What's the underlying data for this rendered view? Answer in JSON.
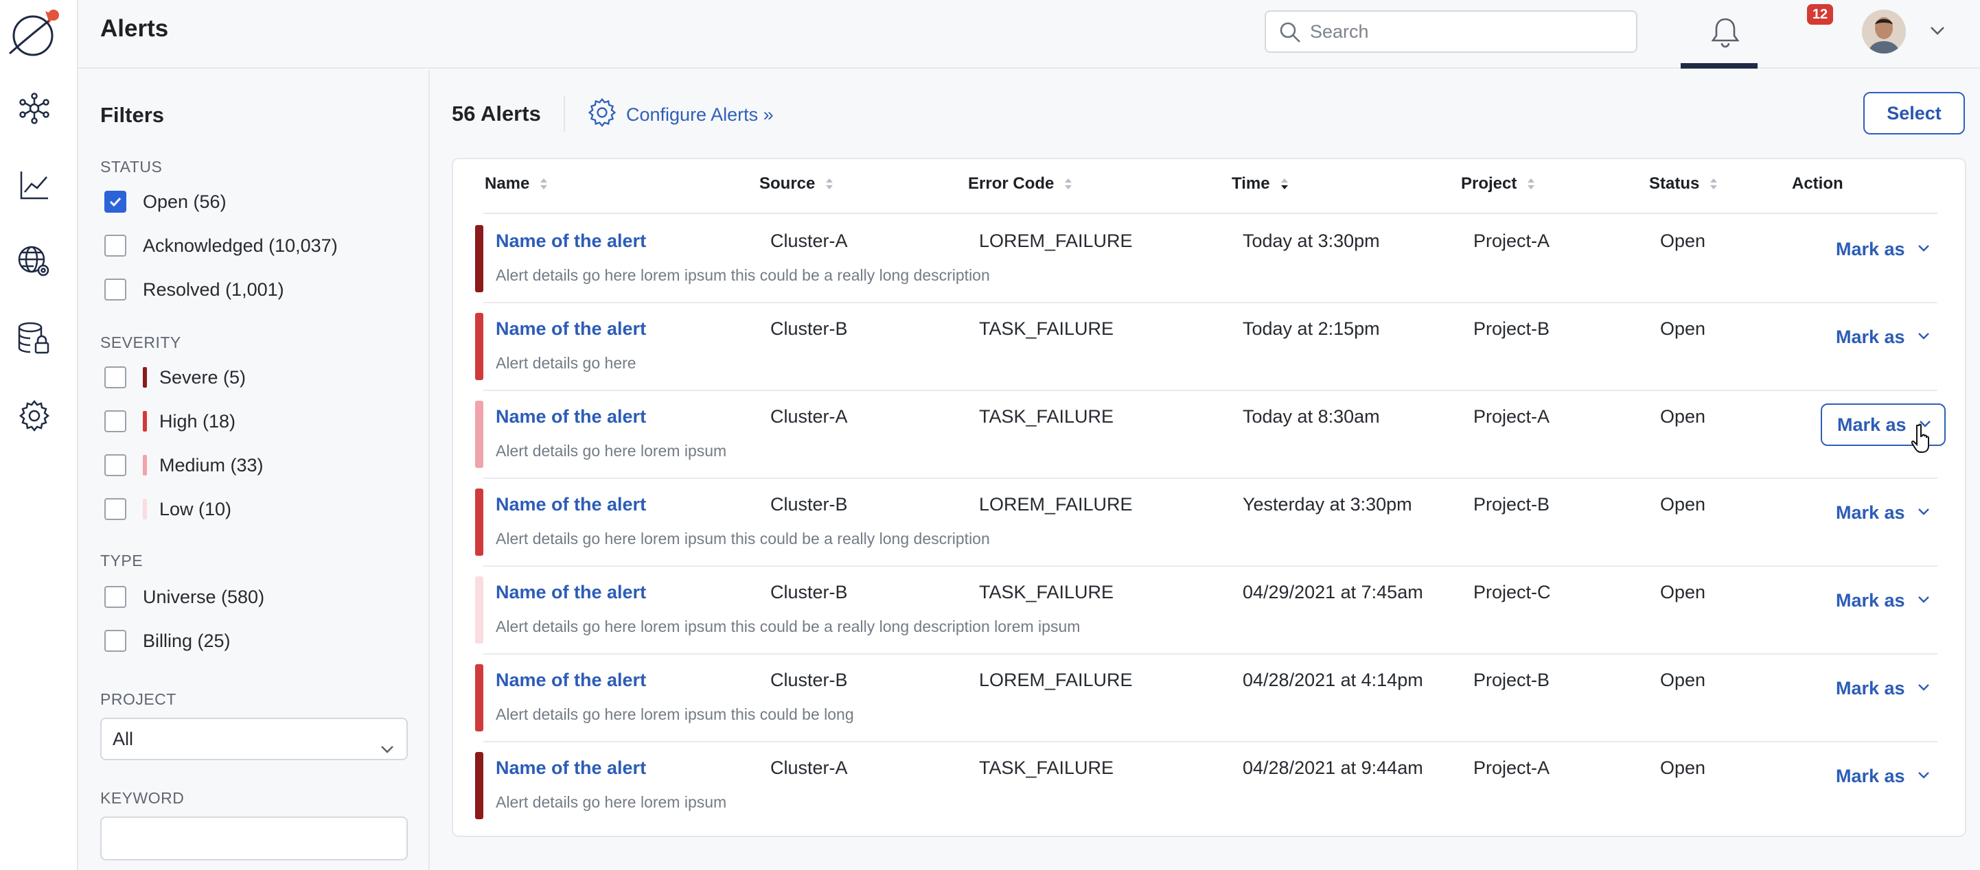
{
  "header": {
    "title": "Alerts",
    "search_placeholder": "Search",
    "notification_count": "12"
  },
  "filters": {
    "title": "Filters",
    "status": {
      "label": "STATUS",
      "options": [
        {
          "label": "Open (56)",
          "checked": true
        },
        {
          "label": "Acknowledged (10,037)",
          "checked": false
        },
        {
          "label": "Resolved (1,001)",
          "checked": false
        }
      ]
    },
    "severity": {
      "label": "SEVERITY",
      "options": [
        {
          "label": "Severe (5)",
          "color": "#8b1a1a"
        },
        {
          "label": "High (18)",
          "color": "#d13a3a"
        },
        {
          "label": "Medium (33)",
          "color": "#f0a3aa"
        },
        {
          "label": "Low (10)",
          "color": "#f9dde0"
        }
      ]
    },
    "type": {
      "label": "TYPE",
      "options": [
        {
          "label": "Universe (580)"
        },
        {
          "label": "Billing (25)"
        }
      ]
    },
    "project": {
      "label": "PROJECT",
      "value": "All"
    },
    "keyword": {
      "label": "KEYWORD",
      "value": ""
    }
  },
  "main": {
    "count": "56 Alerts",
    "configure_label": "Configure Alerts »",
    "select_label": "Select",
    "columns": [
      "Name",
      "Source",
      "Error Code",
      "Time",
      "Project",
      "Status",
      "Action"
    ],
    "rows": [
      {
        "name": "Name of the alert",
        "source": "Cluster-A",
        "error": "LOREM_FAILURE",
        "time": "Today at 3:30pm",
        "project": "Project-A",
        "status": "Open",
        "desc": "Alert details go here lorem ipsum this could be a really long description",
        "severity_color": "#8b1a1a",
        "action": "Mark as"
      },
      {
        "name": "Name of the alert",
        "source": "Cluster-B",
        "error": "TASK_FAILURE",
        "time": "Today at 2:15pm",
        "project": "Project-B",
        "status": "Open",
        "desc": "Alert details go here",
        "severity_color": "#d13a3a",
        "action": "Mark as"
      },
      {
        "name": "Name of the alert",
        "source": "Cluster-A",
        "error": "TASK_FAILURE",
        "time": "Today at 8:30am",
        "project": "Project-A",
        "status": "Open",
        "desc": "Alert details go here lorem ipsum",
        "severity_color": "#f0a3aa",
        "action": "Mark as"
      },
      {
        "name": "Name of the alert",
        "source": "Cluster-B",
        "error": "LOREM_FAILURE",
        "time": "Yesterday at 3:30pm",
        "project": "Project-B",
        "status": "Open",
        "desc": "Alert details go here lorem ipsum this could be a really long description",
        "severity_color": "#d13a3a",
        "action": "Mark as"
      },
      {
        "name": "Name of the alert",
        "source": "Cluster-B",
        "error": "TASK_FAILURE",
        "time": "04/29/2021 at 7:45am",
        "project": "Project-C",
        "status": "Open",
        "desc": "Alert details go here lorem ipsum this could be a really long description lorem ipsum",
        "severity_color": "#f9dde0",
        "action": "Mark as"
      },
      {
        "name": "Name of the alert",
        "source": "Cluster-B",
        "error": "LOREM_FAILURE",
        "time": "04/28/2021 at 4:14pm",
        "project": "Project-B",
        "status": "Open",
        "desc": "Alert details go here lorem ipsum this could be long",
        "severity_color": "#d13a3a",
        "action": "Mark as"
      },
      {
        "name": "Name of the alert",
        "source": "Cluster-A",
        "error": "TASK_FAILURE",
        "time": "04/28/2021 at 9:44am",
        "project": "Project-A",
        "status": "Open",
        "desc": "Alert details go here lorem ipsum",
        "severity_color": "#8b1a1a",
        "action": "Mark as"
      }
    ]
  }
}
